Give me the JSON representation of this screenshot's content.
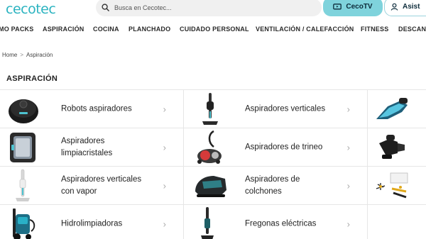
{
  "header": {
    "logo_text": "cecotec",
    "search_placeholder": "Busca en Cecotec...",
    "cecotv_label": "CecoTV",
    "assist_label": "Asist"
  },
  "nav": {
    "items": [
      "MO PACKS",
      "ASPIRACIÓN",
      "COCINA",
      "PLANCHADO",
      "CUIDADO PERSONAL",
      "VENTILACIÓN / CALEFACCIÓN",
      "FITNESS",
      "DESCANS"
    ]
  },
  "breadcrumb": {
    "home": "Home",
    "separator": ">",
    "current": "Aspiración"
  },
  "page_title": "ASPIRACIÓN",
  "categories": [
    {
      "label": "Robots aspiradores",
      "icon": "robot-vacuum-icon"
    },
    {
      "label": "Aspiradores verticales",
      "icon": "stick-vacuum-icon"
    },
    {
      "label": "Aspiradores limpiacristales",
      "icon": "window-cleaner-icon"
    },
    {
      "label": "Aspiradores de trineo",
      "icon": "sled-vacuum-icon"
    },
    {
      "label": "Aspiradores verticales con vapor",
      "icon": "steam-stick-vacuum-icon"
    },
    {
      "label": "Aspiradores de colchones",
      "icon": "mattress-vacuum-icon"
    },
    {
      "label": "Hidrolimpiadoras",
      "icon": "pressure-washer-icon"
    },
    {
      "label": "Fregonas eléctricas",
      "icon": "electric-mop-icon"
    }
  ],
  "colors": {
    "brand": "#2bb3c0",
    "cecotv_bg": "#7fd3dc"
  }
}
